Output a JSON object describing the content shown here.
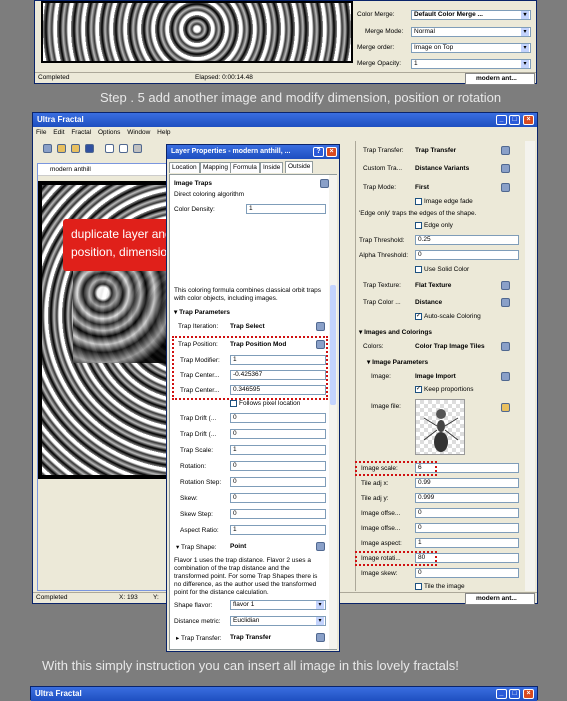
{
  "top_window": {
    "rows": [
      {
        "label": "Color Merge:",
        "value": "Default Color Merge ..."
      },
      {
        "label": "Merge Mode:",
        "value": "Normal"
      },
      {
        "label": "Merge order:",
        "value": "Image on Top"
      },
      {
        "label": "Merge Opacity:",
        "value": "1"
      }
    ],
    "status_left": "Completed",
    "status_elapsed": "Elapsed: 0:00:14.48",
    "status_right": "modern ant..."
  },
  "caption_top": "Step . 5 add another image and modify dimension, position or rotation",
  "caption_bottom": "With this simply instruction you can insert all image in this lovely fractals!",
  "main_window": {
    "title": "Ultra Fractal",
    "menu": [
      "File",
      "Edit",
      "Fractal",
      "Options",
      "Window",
      "Help"
    ],
    "doc_title": "modern anthill",
    "status_left": "Completed",
    "status_x": "X: 193",
    "status_y": "Y:",
    "status_right": "modern ant..."
  },
  "annotation": {
    "line1": "duplicate layer and modify",
    "line2": "position, dimension and rotation"
  },
  "layer_dialog": {
    "title": "Layer Properties - modern anthill, ...",
    "help": "?",
    "tabs": [
      "Location",
      "Mapping",
      "Formula",
      "Inside",
      "Outside"
    ],
    "section_title": "Image Traps",
    "section_subtitle": "Direct coloring algorithm",
    "color_density_label": "Color Density:",
    "color_density_value": "1",
    "desc": "This coloring formula combines classical orbit traps with color objects, including images.",
    "trap_parameters": "Trap Parameters",
    "rows": [
      {
        "label": "Trap Iteration:",
        "value": "Trap Select"
      },
      {
        "label": "Trap Position:",
        "value": "Trap Position Mod"
      },
      {
        "label": "Trap Modifier:",
        "value": "1"
      },
      {
        "label": "Trap Center...",
        "value": "-0.425367"
      },
      {
        "label": "Trap Center...",
        "value": "0.346595"
      }
    ],
    "follows_pixel": "Follows pixel location",
    "rows2": [
      {
        "label": "Trap Drift (...",
        "value": "0"
      },
      {
        "label": "Trap Drift (...",
        "value": "0"
      },
      {
        "label": "Trap Scale:",
        "value": "1"
      },
      {
        "label": "Rotation:",
        "value": "0"
      },
      {
        "label": "Rotation Step:",
        "value": "0"
      },
      {
        "label": "Skew:",
        "value": "0"
      },
      {
        "label": "Skew Step:",
        "value": "0"
      },
      {
        "label": "Aspect Ratio:",
        "value": "1"
      }
    ],
    "trap_shape_label": "Trap Shape:",
    "trap_shape_value": "Point",
    "flavor_desc": "Flavor 1 uses the trap distance. Flavor 2 uses a combination of the trap distance and the transformed point. For some Trap Shapes there is no difference, as the author used the transformed point for the distance calculation.",
    "shape_flavor_label": "Shape flavor:",
    "shape_flavor_value": "flavor 1",
    "distance_metric_label": "Distance metric:",
    "distance_metric_value": "Euclidian",
    "trap_transfer_label": "Trap Transfer:",
    "trap_transfer_value": "Trap Transfer"
  },
  "right_panel": {
    "trap_transfer_label": "Trap Transfer:",
    "trap_transfer_value": "Trap Transfer",
    "custom_tra_label": "Custom Tra...",
    "custom_tra_value": "Distance Variants",
    "trap_mode_label": "Trap Mode:",
    "trap_mode_value": "First",
    "image_edge_fade": "Image edge fade",
    "edge_note": "'Edge only' traps the edges of the shape.",
    "edge_only": "Edge only",
    "trap_threshold_label": "Trap Threshold:",
    "trap_threshold_value": "0.25",
    "alpha_threshold_label": "Alpha Threshold:",
    "alpha_threshold_value": "0",
    "use_solid_color": "Use Solid Color",
    "trap_texture_label": "Trap Texture:",
    "trap_texture_value": "Flat Texture",
    "trap_color_label": "Trap Color ...",
    "trap_color_value": "Distance",
    "auto_scale": "Auto-scale Coloring",
    "images_colorings": "Images and Colorings",
    "colors_label": "Colors:",
    "colors_value": "Color Trap Image Tiles",
    "image_parameters": "Image Parameters",
    "image_label": "Image:",
    "image_value": "Image Import",
    "keep_proportions": "Keep proportions",
    "image_file_label": "Image file:",
    "rows": [
      {
        "label": "Image scale:",
        "value": "6"
      },
      {
        "label": "Tile adj x:",
        "value": "0.99"
      },
      {
        "label": "Tile adj y:",
        "value": "0.999"
      },
      {
        "label": "Image offse...",
        "value": "0"
      },
      {
        "label": "Image offse...",
        "value": "0"
      },
      {
        "label": "Image aspect:",
        "value": "1"
      },
      {
        "label": "Image rotati...",
        "value": "80"
      },
      {
        "label": "Image skew:",
        "value": "0"
      }
    ],
    "tile_the_image": "Tile the image"
  },
  "bottom_window": {
    "title": "Ultra Fractal"
  }
}
